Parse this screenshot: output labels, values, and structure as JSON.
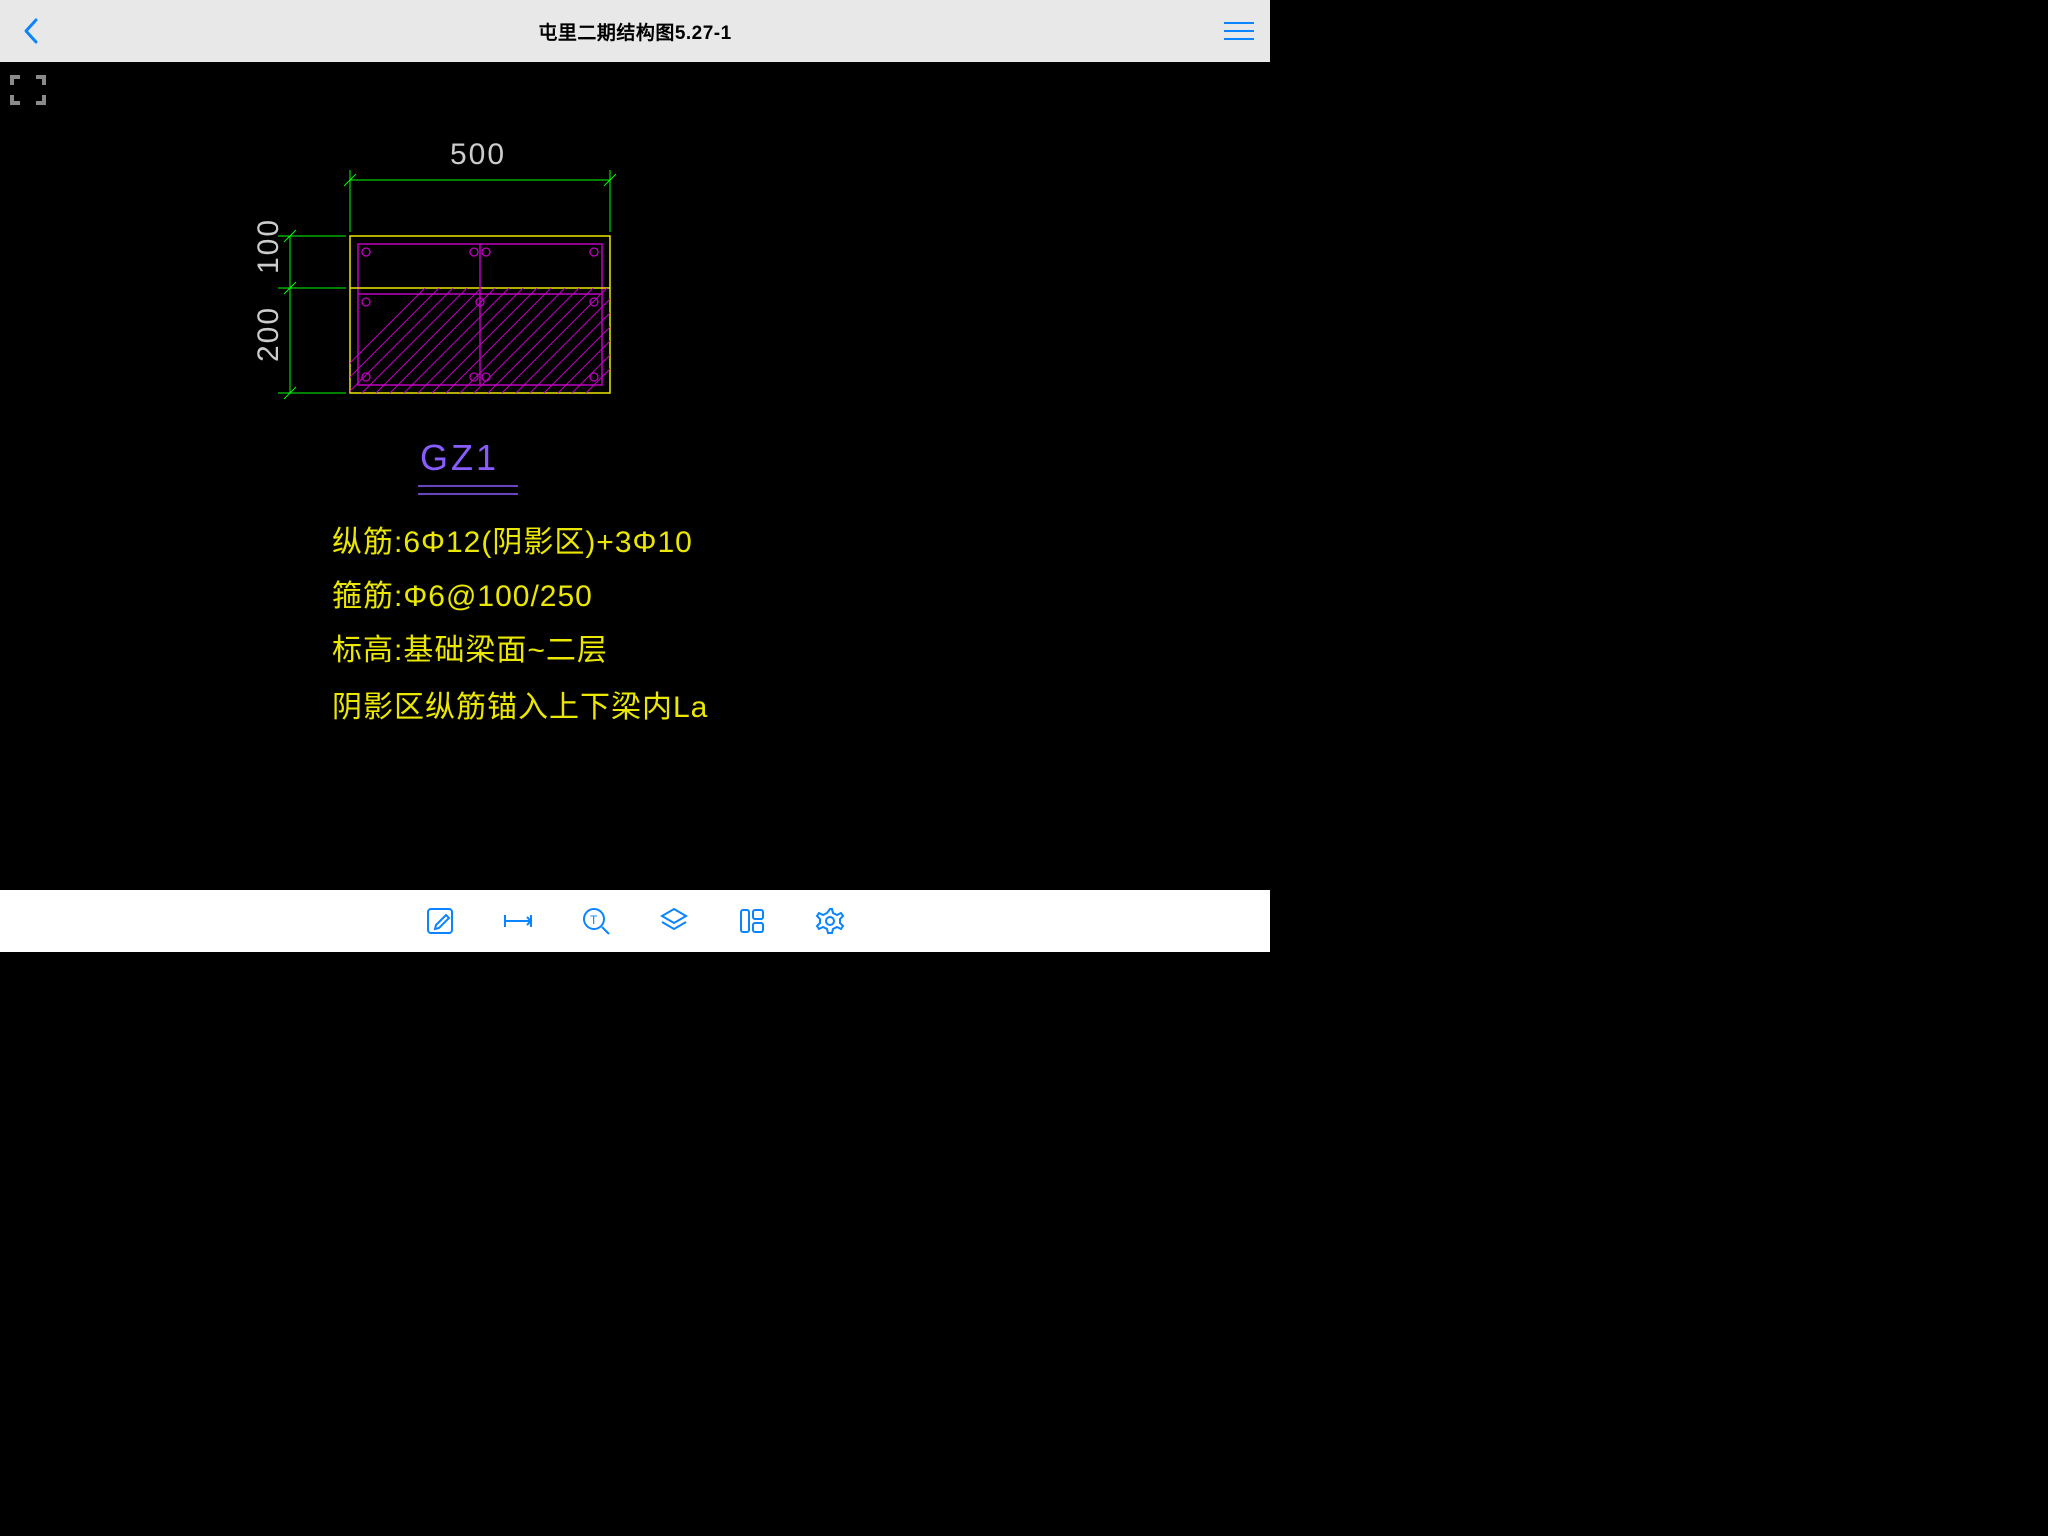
{
  "header": {
    "title": "屯里二期结构图5.27-1"
  },
  "dimensions": {
    "width": "500",
    "height_top": "100",
    "height_bottom": "200"
  },
  "annotation": {
    "label": "GZ1",
    "lines": [
      "纵筋:6Φ12(阴影区)+3Φ10",
      "箍筋:Φ6@100/250",
      "标高:基础梁面~二层",
      "阴影区纵筋锚入上下梁内La"
    ]
  },
  "icons": {
    "back": "back-chevron-icon",
    "menu": "hamburger-icon",
    "fullscreen": "fullscreen-icon",
    "edit": "edit-icon",
    "measure": "measure-icon",
    "zoom": "zoom-text-icon",
    "layers": "layers-icon",
    "layout": "layout-icon",
    "settings": "gear-icon"
  }
}
